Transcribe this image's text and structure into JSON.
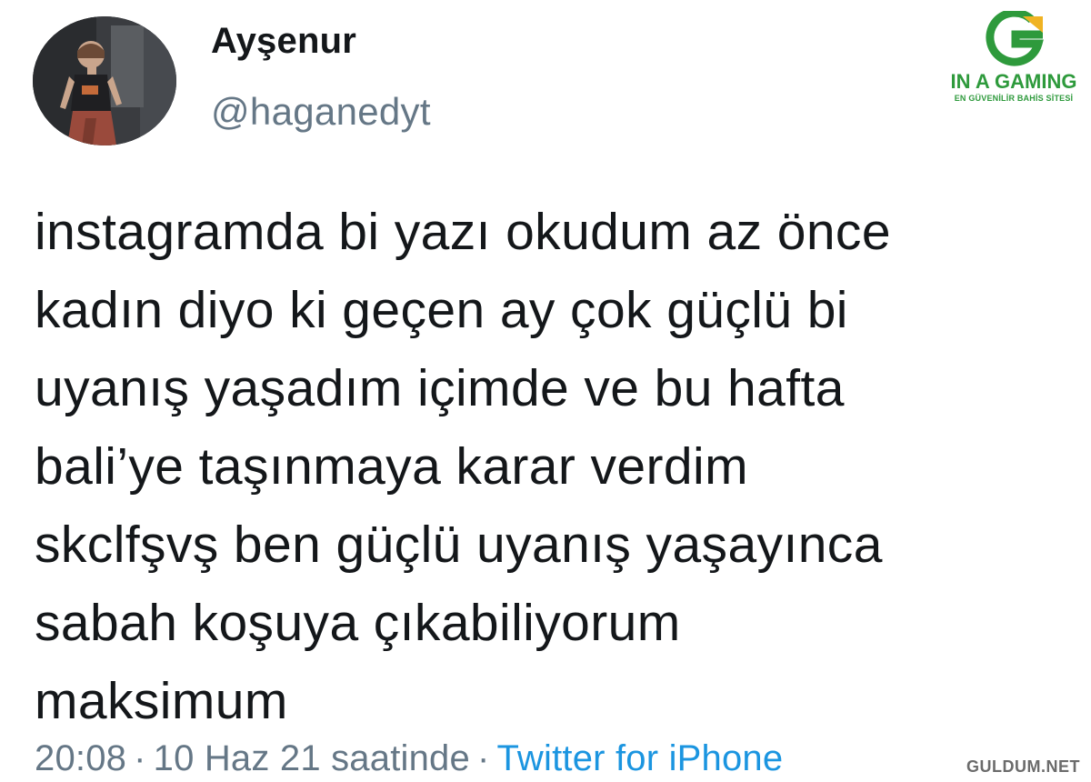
{
  "tweet": {
    "display_name": "Ayşenur",
    "handle": "@haganedyt",
    "text_lines": [
      "instagramda bi yazı okudum az önce",
      "kadın diyo ki geçen ay çok güçlü bi",
      "uyanış yaşadım içimde ve bu hafta",
      "bali’ye taşınmaya karar verdim",
      "skclfşvş ben güçlü uyanış yaşayınca",
      "sabah koşuya çıkabiliyorum",
      "maksimum"
    ],
    "time": "20:08",
    "separator": "·",
    "date": "10 Haz 21 saatinde",
    "source": "Twitter for iPhone"
  },
  "brand": {
    "name": "IN A GAMING",
    "tagline": "EN GÜVENİLİR BAHİS SİTESİ",
    "logo_icon": "g-logo-icon",
    "primary_color": "#2e9a3c",
    "accent_color": "#f0b323"
  },
  "watermark": {
    "text": "GULDUM.NET"
  },
  "colors": {
    "text": "#14171a",
    "secondary": "#657786",
    "link": "#1b95e0"
  }
}
